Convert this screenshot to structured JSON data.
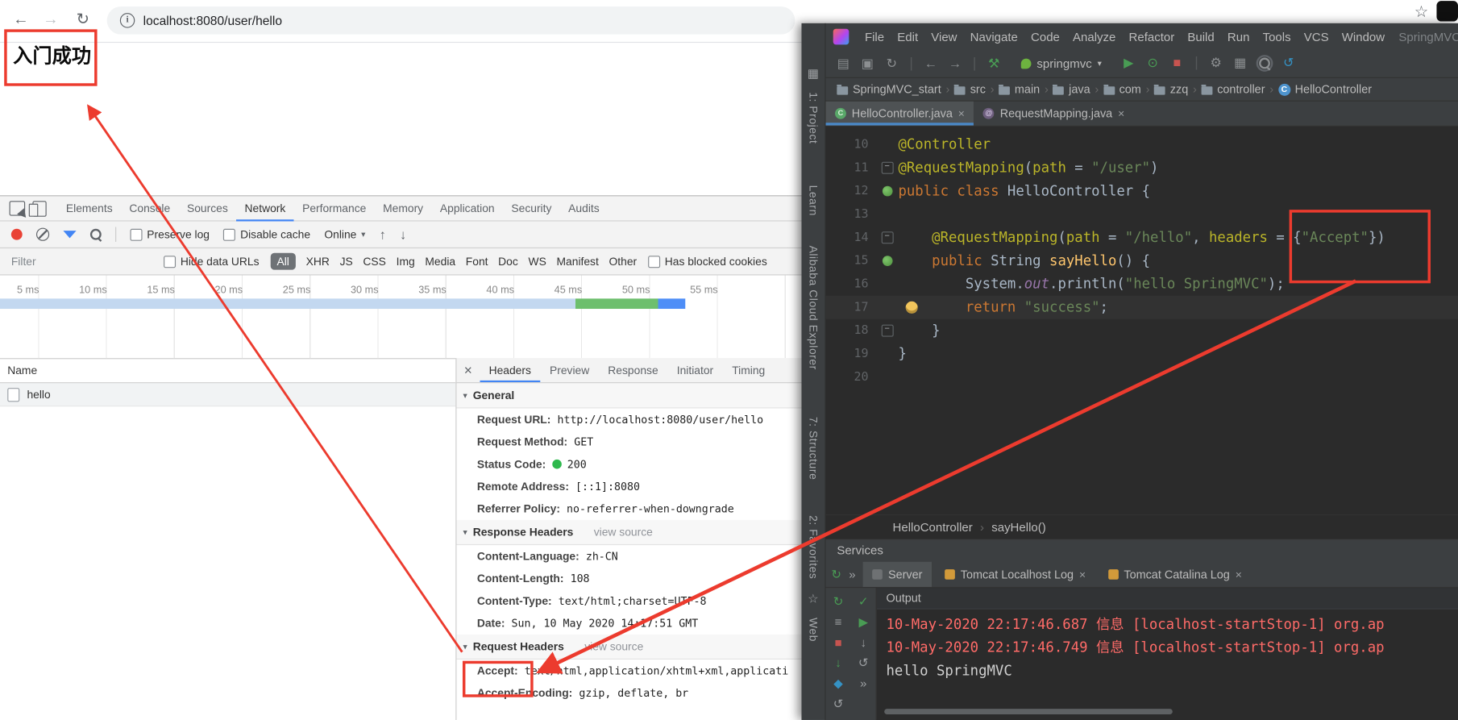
{
  "icons": {
    "back": "←",
    "forward": "→",
    "reload": "↻",
    "bookmark_star": "☆",
    "caret_down": "▾",
    "close": "×",
    "overflow": "»",
    "import_har": "↑",
    "export_har": "↓",
    "disclosure": "▾"
  },
  "browser": {
    "toolbar": {
      "url": "localhost:8080/user/hello",
      "info_badge": "i"
    },
    "page": {
      "body_text": "入门成功"
    },
    "devtools": {
      "tabs": [
        "Elements",
        "Console",
        "Sources",
        "Network",
        "Performance",
        "Memory",
        "Application",
        "Security",
        "Audits"
      ],
      "selected_tab": "Network",
      "network_toolbar": {
        "preserve_log": "Preserve log",
        "disable_cache": "Disable cache",
        "throttling": "Online"
      },
      "filter_bar": {
        "filter_placeholder": "Filter",
        "hide_data_urls": "Hide data URLs",
        "types": [
          "All",
          "XHR",
          "JS",
          "CSS",
          "Img",
          "Media",
          "Font",
          "Doc",
          "WS",
          "Manifest",
          "Other"
        ],
        "selected_type": "All",
        "has_blocked_cookies": "Has blocked cookies"
      },
      "timeline": {
        "ticks": [
          "5 ms",
          "10 ms",
          "15 ms",
          "20 ms",
          "25 ms",
          "30 ms",
          "35 ms",
          "40 ms",
          "45 ms",
          "50 ms",
          "55 ms"
        ]
      },
      "requests": {
        "name_header": "Name",
        "rows": [
          "hello"
        ]
      },
      "details": {
        "tabs": [
          "Headers",
          "Preview",
          "Response",
          "Initiator",
          "Timing"
        ],
        "selected_tab": "Headers",
        "sections": [
          {
            "title": "General",
            "rows": [
              {
                "label": "Request URL:",
                "value": "http://localhost:8080/user/hello"
              },
              {
                "label": "Request Method:",
                "value": "GET"
              },
              {
                "label": "Status Code:",
                "value": "200",
                "status_dot": true
              },
              {
                "label": "Remote Address:",
                "value": "[::1]:8080"
              },
              {
                "label": "Referrer Policy:",
                "value": "no-referrer-when-downgrade"
              }
            ]
          },
          {
            "title": "Response Headers",
            "link": "view source",
            "rows": [
              {
                "label": "Content-Language:",
                "value": "z​h-CN"
              },
              {
                "label": "Content-Length:",
                "value": "108"
              },
              {
                "label": "Content-Type:",
                "value": "text/html;charset=UTF-8"
              },
              {
                "label": "Date:",
                "value": "Sun, 10 May 2020 14:17:51 GMT"
              }
            ]
          },
          {
            "title": "Request Headers",
            "link": "view source",
            "rows": [
              {
                "label": "Accept:",
                "value": "text/html,application/xhtml+xml,applicati"
              },
              {
                "label": "Accept-Encoding:",
                "value": "gzip, deflate, br"
              }
            ]
          }
        ]
      }
    }
  },
  "ide": {
    "menu": [
      "File",
      "Edit",
      "View",
      "Navigate",
      "Code",
      "Analyze",
      "Refactor",
      "Build",
      "Run",
      "Tools",
      "VCS",
      "Window"
    ],
    "title_tail": "SpringMVC",
    "run_config": "springmvc",
    "toolbar_icons_left": [
      {
        "g": "▤",
        "c": "dim",
        "n": "open-folder"
      },
      {
        "g": "▣",
        "c": "dim",
        "n": "save-all"
      },
      {
        "g": "↻",
        "c": "dim",
        "n": "synchronize"
      },
      {
        "g": "|",
        "c": "sep",
        "n": "separator"
      },
      {
        "g": "←",
        "c": "dim",
        "n": "back"
      },
      {
        "g": "→",
        "c": "dim",
        "n": "forward"
      },
      {
        "g": "|",
        "c": "sep",
        "n": "separator"
      },
      {
        "g": "⚒",
        "c": "green",
        "n": "build-project"
      }
    ],
    "toolbar_icons_right": [
      {
        "g": "▶",
        "c": "green",
        "n": "run"
      },
      {
        "g": "⊙",
        "c": "green",
        "n": "debug"
      },
      {
        "g": "■",
        "c": "red",
        "n": "stop"
      },
      {
        "g": "|",
        "c": "sep",
        "n": "separator"
      },
      {
        "g": "⚙",
        "c": "dim",
        "n": "settings"
      },
      {
        "g": "▦",
        "c": "dim",
        "n": "project-structure"
      },
      {
        "g": "",
        "c": "mag",
        "n": "search-everywhere"
      },
      {
        "g": "↺",
        "c": "teal",
        "n": "update-project"
      }
    ],
    "breadcrumbs": [
      "SpringMVC_start",
      "src",
      "main",
      "java",
      "com",
      "zzq",
      "controller",
      "HelloController"
    ],
    "editor_tabs": [
      {
        "label": "HelloController.java",
        "selected": true
      },
      {
        "label": "RequestMapping.java",
        "selected": false
      }
    ],
    "code": {
      "lines": [
        {
          "num": 10,
          "tokens": [
            [
              "@Controller",
              "ann"
            ]
          ]
        },
        {
          "num": 11,
          "fold": true,
          "tokens": [
            [
              "@RequestMapping",
              "ann"
            ],
            [
              "(",
              "pln"
            ],
            [
              "path ",
              "ann"
            ],
            [
              "= ",
              "pln"
            ],
            [
              "\"/user\"",
              "str"
            ],
            [
              ")",
              "pln"
            ]
          ]
        },
        {
          "num": 12,
          "gutter": "bean",
          "tokens": [
            [
              "public class ",
              "kw"
            ],
            [
              "HelloController {",
              "pln"
            ]
          ]
        },
        {
          "num": 13,
          "tokens": []
        },
        {
          "num": 14,
          "fold": true,
          "tokens": [
            [
              "    ",
              "pln"
            ],
            [
              "@RequestMapping",
              "ann"
            ],
            [
              "(",
              "pln"
            ],
            [
              "path ",
              "ann"
            ],
            [
              "= ",
              "pln"
            ],
            [
              "\"/hello\"",
              "str"
            ],
            [
              ", ",
              "pln"
            ],
            [
              "headers ",
              "ann"
            ],
            [
              "= {",
              "pln"
            ],
            [
              "\"Accept\"",
              "str"
            ],
            [
              "})",
              "pln"
            ]
          ]
        },
        {
          "num": 15,
          "gutter": "bean",
          "tokens": [
            [
              "    ",
              "pln"
            ],
            [
              "public ",
              "kw"
            ],
            [
              "String ",
              "pln"
            ],
            [
              "sayHello",
              "fn"
            ],
            [
              "() {",
              "pln"
            ]
          ]
        },
        {
          "num": 16,
          "tokens": [
            [
              "        ",
              "pln"
            ],
            [
              "System",
              "pln"
            ],
            [
              ".",
              "pln"
            ],
            [
              "out",
              "fld"
            ],
            [
              ".",
              "pln"
            ],
            [
              "println",
              "pln"
            ],
            [
              "(",
              "pln"
            ],
            [
              "\"hello SpringMVC\"",
              "str"
            ],
            [
              ");",
              "pln"
            ]
          ]
        },
        {
          "num": 17,
          "bulb": true,
          "caret": true,
          "tokens": [
            [
              "        ",
              "pln"
            ],
            [
              "return ",
              "kw"
            ],
            [
              "\"success\"",
              "str"
            ],
            [
              ";",
              "pln"
            ]
          ]
        },
        {
          "num": 18,
          "fold": true,
          "tokens": [
            [
              "    }",
              "pln"
            ]
          ]
        },
        {
          "num": 19,
          "tokens": [
            [
              "}",
              "pln"
            ]
          ]
        },
        {
          "num": 20,
          "tokens": []
        }
      ]
    },
    "editor_breadcrumb": [
      "HelloController",
      "sayHello()"
    ],
    "services": {
      "title": "Services",
      "tabs": [
        {
          "label": "Server",
          "selected": true
        },
        {
          "label": "Tomcat Localhost Log",
          "closable": true
        },
        {
          "label": "Tomcat Catalina Log",
          "closable": true
        }
      ],
      "left_icons": [
        {
          "g": "↻",
          "c": "green",
          "n": "rerun"
        },
        {
          "g": "≡",
          "c": "dim",
          "n": "options"
        },
        {
          "g": "■",
          "c": "red",
          "n": "stop"
        },
        {
          "g": "↓",
          "c": "green",
          "n": "deploy"
        },
        {
          "g": "◆",
          "c": "teal",
          "n": "services-view"
        },
        {
          "g": "↺",
          "c": "dim",
          "n": "refresh"
        }
      ],
      "run_icons": [
        {
          "g": "✓",
          "c": "green",
          "n": "up-to-date"
        },
        {
          "g": "▶",
          "c": "green",
          "n": "run-tab"
        },
        {
          "g": "↓",
          "c": "dim",
          "n": "scroll-to-end"
        },
        {
          "g": "↺",
          "c": "dim",
          "n": "soft-wrap"
        },
        {
          "g": "»",
          "c": "dim",
          "n": "more"
        }
      ],
      "output_label": "Output",
      "log": [
        {
          "text": "10-May-2020 22:17:46.687 信息 [localhost-startStop-1] org.ap",
          "type": "error"
        },
        {
          "text": "10-May-2020 22:17:46.749 信息 [localhost-startStop-1] org.ap",
          "type": "error"
        },
        {
          "text": "hello SpringMVC",
          "type": "plain"
        }
      ]
    },
    "tool_stripe": [
      "1: Project",
      "Learn",
      "Alibaba Cloud Explorer",
      "7: Structure",
      "2: Favorites",
      "Web"
    ]
  },
  "annotation_color": "#ec3b2e"
}
